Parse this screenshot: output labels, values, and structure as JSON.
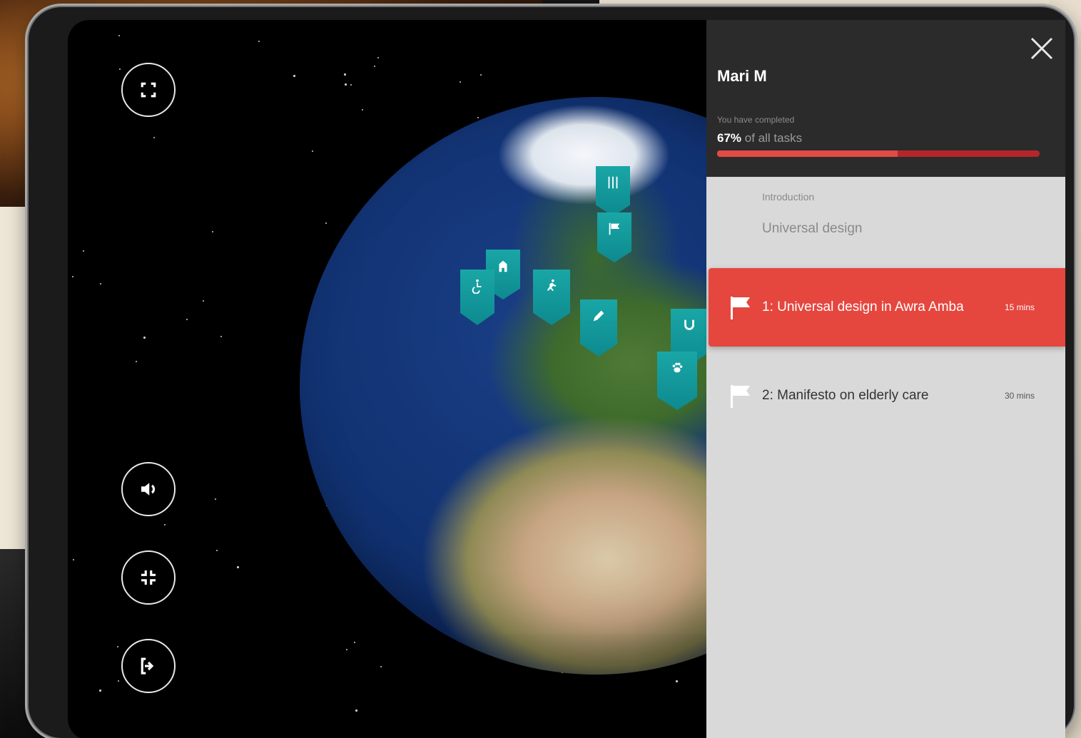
{
  "user": {
    "name": "Mari M"
  },
  "progress": {
    "caption": "You have completed",
    "percent_label": "67%",
    "suffix": " of all tasks",
    "fraction": 0.56
  },
  "sections": [
    {
      "label": "Introduction"
    },
    {
      "label": "Universal design"
    }
  ],
  "tasks": [
    {
      "title": "1: Universal design in Awra Amba",
      "time": "15 mins",
      "active": true
    },
    {
      "title": "2: Manifesto on elderly care",
      "time": "30 mins",
      "active": false
    }
  ],
  "colors": {
    "accent": "#e5463e",
    "pin": "#0d8a8f",
    "panel": "#d9d9d9",
    "header": "#2b2b2b"
  },
  "icons": {
    "fullscreen": "expand-icon",
    "sound": "speaker-icon",
    "collapse": "compress-icon",
    "exit": "exit-icon",
    "close": "close-icon",
    "flag": "flag-icon"
  }
}
